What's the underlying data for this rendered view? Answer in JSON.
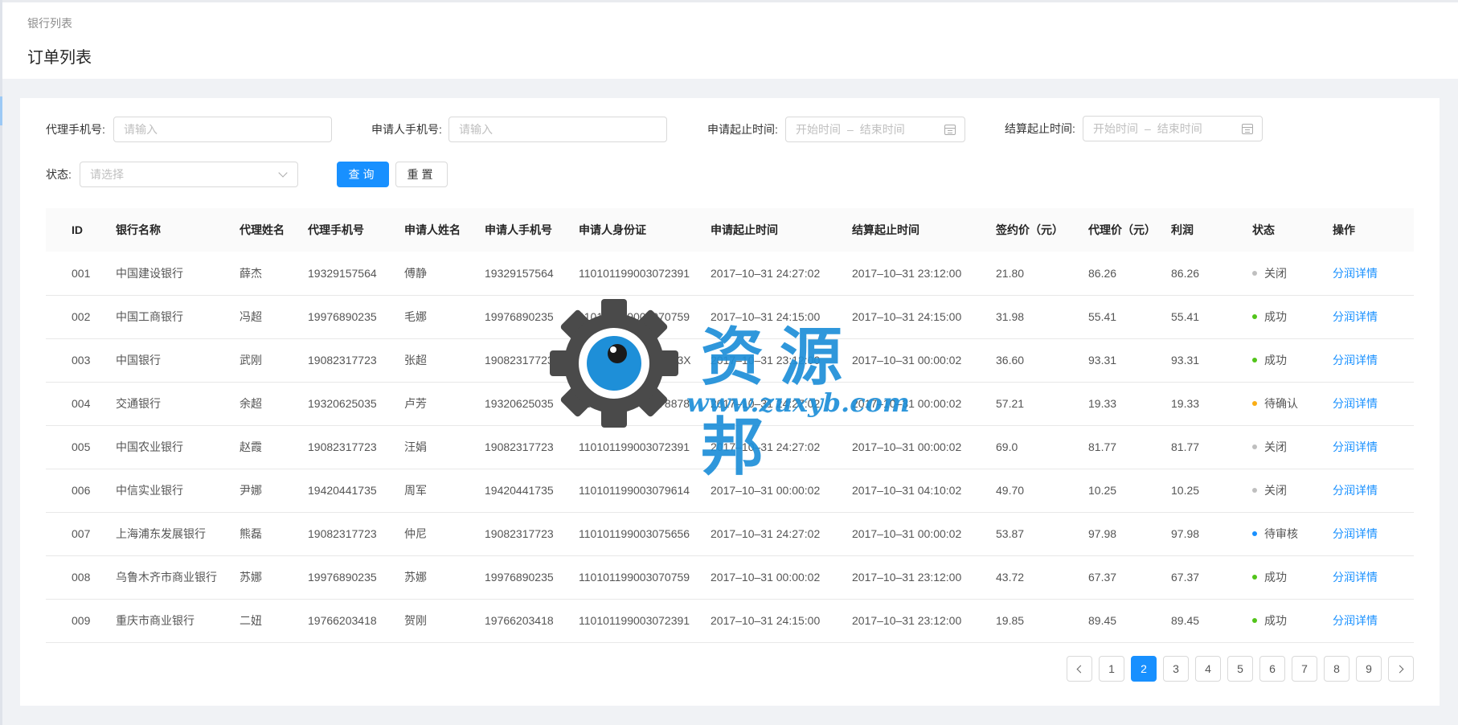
{
  "header": {
    "breadcrumb": "银行列表",
    "title": "订单列表"
  },
  "filters": {
    "agent_phone": {
      "label": "代理手机号:",
      "placeholder": "请输入"
    },
    "applicant_phone": {
      "label": "申请人手机号:",
      "placeholder": "请输入"
    },
    "apply_time": {
      "label": "申请起止时间:",
      "start_placeholder": "开始时间",
      "separator": "–",
      "end_placeholder": "结束时间"
    },
    "settle_time": {
      "label": "结算起止时间:",
      "start_placeholder": "开始时间",
      "separator": "–",
      "end_placeholder": "结束时间"
    },
    "status": {
      "label": "状态:",
      "placeholder": "请选择"
    },
    "query_label": "查询",
    "reset_label": "重置"
  },
  "table": {
    "columns": [
      "ID",
      "银行名称",
      "代理姓名",
      "代理手机号",
      "申请人姓名",
      "申请人手机号",
      "申请人身份证",
      "申请起止时间",
      "结算起止时间",
      "签约价（元）",
      "代理价（元）",
      "利润",
      "状态",
      "操作"
    ],
    "rows": [
      {
        "id": "001",
        "bank": "中国建设银行",
        "agent": "薛杰",
        "agent_phone": "19329157564",
        "applicant": "傅静",
        "applicant_phone": "19329157564",
        "id_card": "110101199003072391",
        "apply_time": "2017–10–31  24:27:02",
        "settle_time": "2017–10–31  23:12:00",
        "sign_price": "21.80",
        "agent_price": "86.26",
        "profit": "86.26",
        "status": "关闭",
        "status_color": "#bfbfbf",
        "action": "分润详情"
      },
      {
        "id": "002",
        "bank": "中国工商银行",
        "agent": "冯超",
        "agent_phone": "19976890235",
        "applicant": "毛娜",
        "applicant_phone": "19976890235",
        "id_card": "110101199003070759",
        "apply_time": "2017–10–31  24:15:00",
        "settle_time": "2017–10–31  24:15:00",
        "sign_price": "31.98",
        "agent_price": "55.41",
        "profit": "55.41",
        "status": "成功",
        "status_color": "#52c41a",
        "action": "分润详情"
      },
      {
        "id": "003",
        "bank": "中国银行",
        "agent": "武刚",
        "agent_phone": "19082317723",
        "applicant": "张超",
        "applicant_phone": "19082317723",
        "id_card": "11010119900307183X",
        "apply_time": "2017–10–31  23:12:00",
        "settle_time": "2017–10–31  00:00:02",
        "sign_price": "36.60",
        "agent_price": "93.31",
        "profit": "93.31",
        "status": "成功",
        "status_color": "#52c41a",
        "action": "分润详情"
      },
      {
        "id": "004",
        "bank": "交通银行",
        "agent": "余超",
        "agent_phone": "19320625035",
        "applicant": "卢芳",
        "applicant_phone": "19320625035",
        "id_card": "110101199003078878",
        "apply_time": "2017–10–31  24:27:02",
        "settle_time": "2017–10–31  00:00:02",
        "sign_price": "57.21",
        "agent_price": "19.33",
        "profit": "19.33",
        "status": "待确认",
        "status_color": "#faad14",
        "action": "分润详情"
      },
      {
        "id": "005",
        "bank": "中国农业银行",
        "agent": "赵霞",
        "agent_phone": "19082317723",
        "applicant": "汪娟",
        "applicant_phone": "19082317723",
        "id_card": "110101199003072391",
        "apply_time": "2017–10–31  24:27:02",
        "settle_time": "2017–10–31  00:00:02",
        "sign_price": "69.0",
        "agent_price": "81.77",
        "profit": "81.77",
        "status": "关闭",
        "status_color": "#bfbfbf",
        "action": "分润详情"
      },
      {
        "id": "006",
        "bank": "中信实业银行",
        "agent": "尹娜",
        "agent_phone": "19420441735",
        "applicant": "周军",
        "applicant_phone": "19420441735",
        "id_card": "110101199003079614",
        "apply_time": "2017–10–31  00:00:02",
        "settle_time": "2017–10–31  04:10:02",
        "sign_price": "49.70",
        "agent_price": "10.25",
        "profit": "10.25",
        "status": "关闭",
        "status_color": "#bfbfbf",
        "action": "分润详情"
      },
      {
        "id": "007",
        "bank": "上海浦东发展银行",
        "agent": "熊磊",
        "agent_phone": "19082317723",
        "applicant": "仲尼",
        "applicant_phone": "19082317723",
        "id_card": "110101199003075656",
        "apply_time": "2017–10–31  24:27:02",
        "settle_time": "2017–10–31  00:00:02",
        "sign_price": "53.87",
        "agent_price": "97.98",
        "profit": "97.98",
        "status": "待审核",
        "status_color": "#1890ff",
        "action": "分润详情"
      },
      {
        "id": "008",
        "bank": "乌鲁木齐市商业银行",
        "agent": "苏娜",
        "agent_phone": "19976890235",
        "applicant": "苏娜",
        "applicant_phone": "19976890235",
        "id_card": "110101199003070759",
        "apply_time": "2017–10–31  00:00:02",
        "settle_time": "2017–10–31  23:12:00",
        "sign_price": "43.72",
        "agent_price": "67.37",
        "profit": "67.37",
        "status": "成功",
        "status_color": "#52c41a",
        "action": "分润详情"
      },
      {
        "id": "009",
        "bank": "重庆市商业银行",
        "agent": "二妞",
        "agent_phone": "19766203418",
        "applicant": "贺刚",
        "applicant_phone": "19766203418",
        "id_card": "110101199003072391",
        "apply_time": "2017–10–31  24:15:00",
        "settle_time": "2017–10–31  23:12:00",
        "sign_price": "19.85",
        "agent_price": "89.45",
        "profit": "89.45",
        "status": "成功",
        "status_color": "#52c41a",
        "action": "分润详情"
      }
    ]
  },
  "pagination": {
    "pages": [
      "1",
      "2",
      "3",
      "4",
      "5",
      "6",
      "7",
      "8",
      "9"
    ],
    "current": "2"
  },
  "watermark": {
    "title": "资源邦",
    "url": "www.zuxyb.com"
  },
  "colors": {
    "primary": "#1890ff",
    "success": "#52c41a",
    "warning": "#faad14",
    "closed": "#bfbfbf"
  }
}
